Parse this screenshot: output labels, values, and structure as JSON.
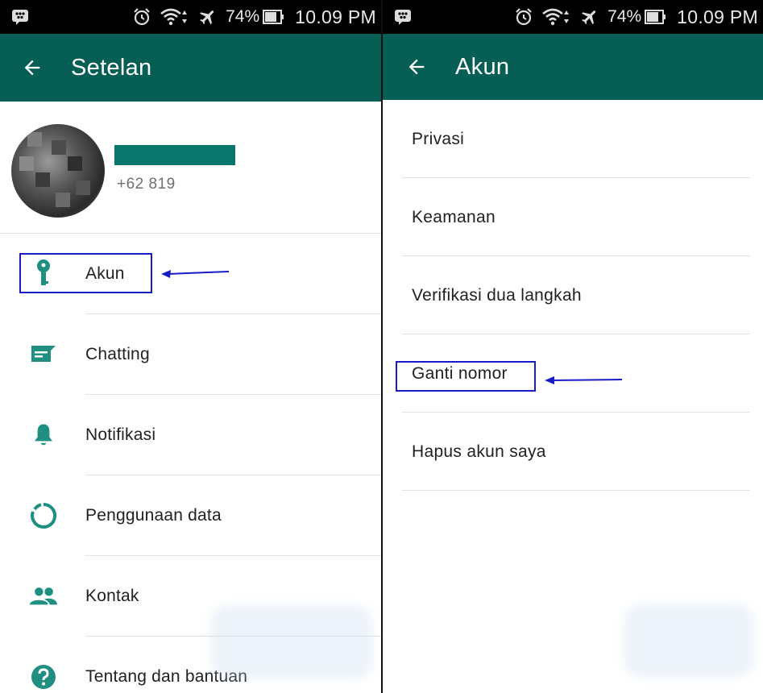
{
  "status_bar": {
    "battery": "74%",
    "time": "10.09 PM"
  },
  "left": {
    "title": "Setelan",
    "profile": {
      "phone": "+62 819"
    },
    "items": [
      {
        "label": "Akun",
        "icon": "key-icon"
      },
      {
        "label": "Chatting",
        "icon": "chat-icon"
      },
      {
        "label": "Notifikasi",
        "icon": "bell-icon"
      },
      {
        "label": "Penggunaan data",
        "icon": "data-usage-icon"
      },
      {
        "label": "Kontak",
        "icon": "contacts-icon"
      },
      {
        "label": "Tentang dan bantuan",
        "icon": "help-icon"
      }
    ]
  },
  "right": {
    "title": "Akun",
    "items": [
      {
        "label": "Privasi"
      },
      {
        "label": "Keamanan"
      },
      {
        "label": "Verifikasi dua langkah"
      },
      {
        "label": "Ganti nomor"
      },
      {
        "label": "Hapus akun saya"
      }
    ]
  },
  "colors": {
    "app_bar": "#075e54",
    "icon_teal": "#1f8f81",
    "highlight": "#1a1ac8"
  }
}
